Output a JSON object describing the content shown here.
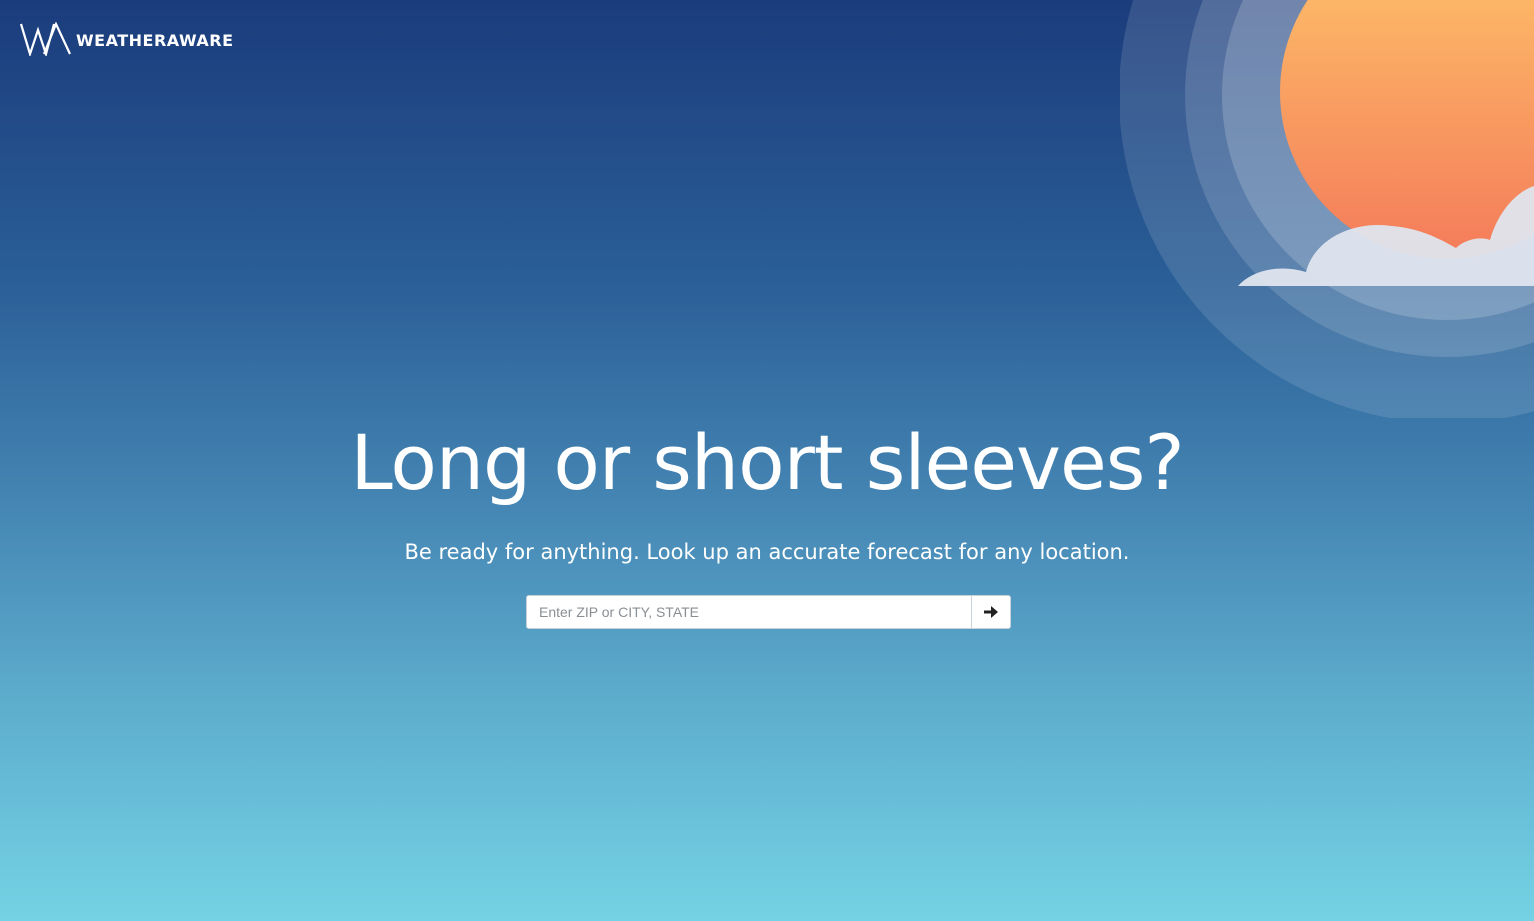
{
  "brand": {
    "logo_mark": "WA",
    "name": "WEATHERAWARE",
    "logo_icon": "wa-monogram-icon"
  },
  "hero": {
    "title": "Long or short sleeves?",
    "subtitle": "Be ready for anything. Look up an accurate forecast for any location."
  },
  "search": {
    "placeholder": "Enter ZIP or CITY, STATE",
    "value": "",
    "submit_icon": "arrow-right-icon"
  },
  "colors": {
    "sky_top": "#1b3c7c",
    "sky_bottom": "#74d2e4",
    "sun_top": "#fec66a",
    "sun_bottom": "#f47b5a",
    "cloud": "#dfe5ee"
  },
  "decoration": {
    "illustration": "sun-behind-cloud-illustration"
  }
}
